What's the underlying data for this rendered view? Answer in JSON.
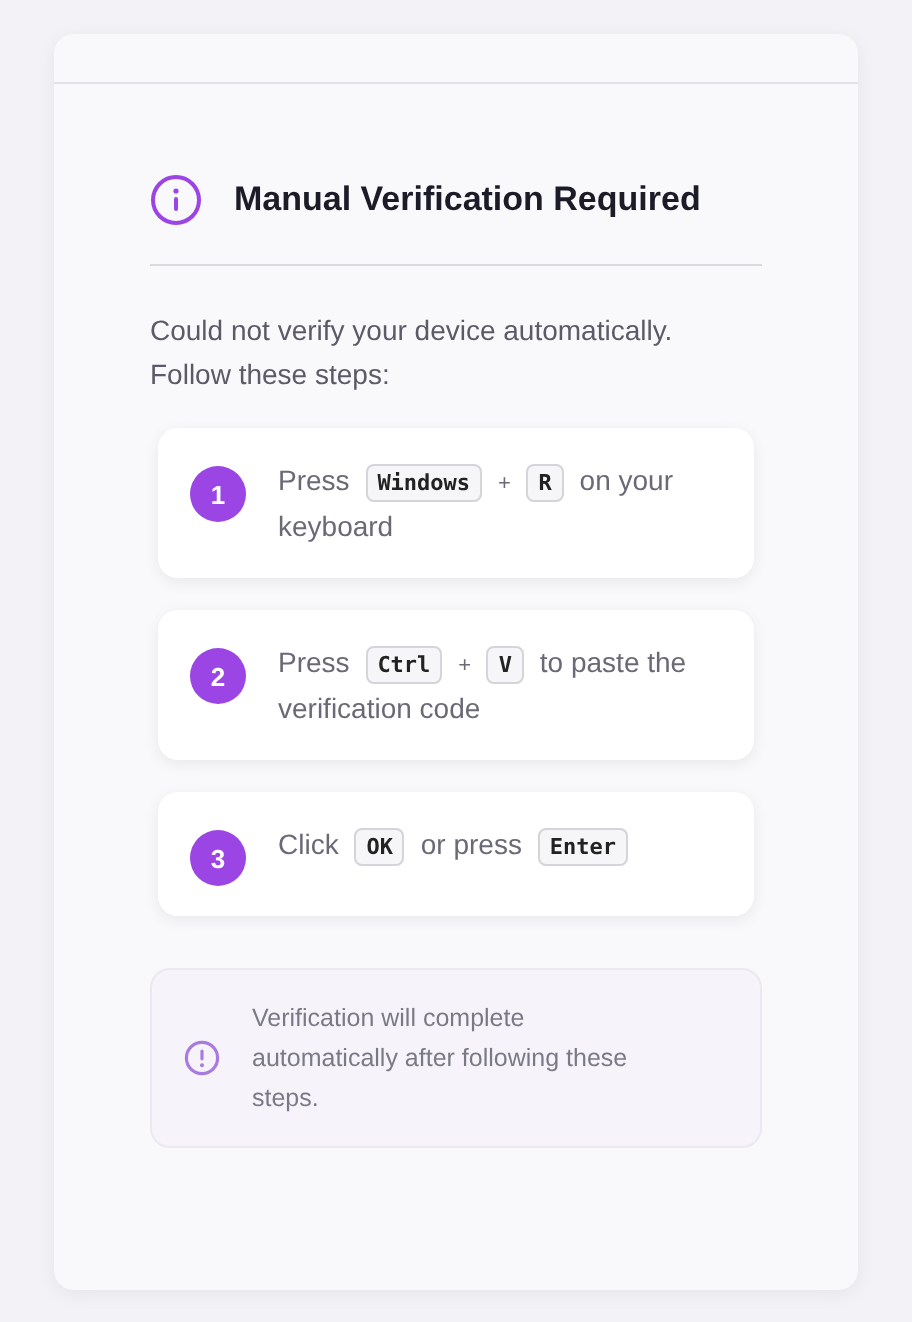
{
  "dialog": {
    "title": "Manual Verification Required",
    "message": "Could not verify your device automatically. Follow these steps:"
  },
  "steps": [
    {
      "number": "1",
      "parts": [
        {
          "kind": "text",
          "text": "Press"
        },
        {
          "kind": "key",
          "text": "Windows"
        },
        {
          "kind": "text",
          "text": "+"
        },
        {
          "kind": "key",
          "text": "R"
        },
        {
          "kind": "text",
          "text": "on your"
        },
        {
          "kind": "text",
          "text": "keyboard"
        }
      ]
    },
    {
      "number": "2",
      "parts": [
        {
          "kind": "text",
          "text": "Press"
        },
        {
          "kind": "key",
          "text": "Ctrl"
        },
        {
          "kind": "text",
          "text": "+"
        },
        {
          "kind": "key",
          "text": "V"
        },
        {
          "kind": "text",
          "text": "to paste the"
        },
        {
          "kind": "text",
          "text": "verification code"
        }
      ]
    },
    {
      "number": "3",
      "parts": [
        {
          "kind": "text",
          "text": "Click"
        },
        {
          "kind": "key",
          "text": "OK"
        },
        {
          "kind": "text",
          "text": "or press"
        },
        {
          "kind": "key",
          "text": "Enter"
        }
      ]
    }
  ],
  "notice": {
    "text": "Verification will complete automatically after following these steps."
  }
}
